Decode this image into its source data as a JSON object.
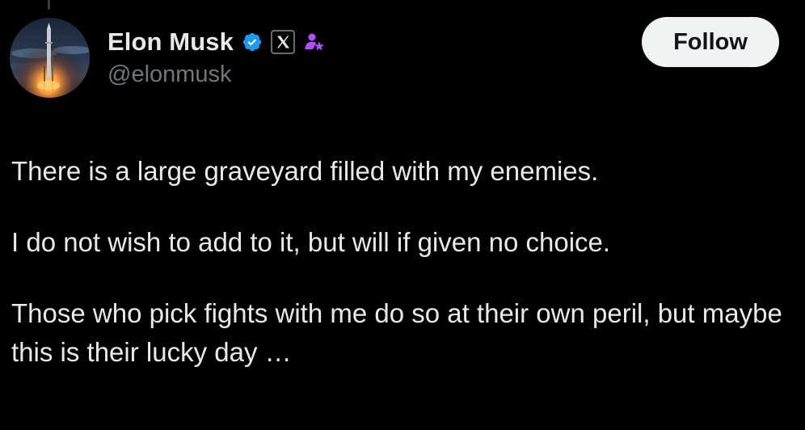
{
  "tweet": {
    "author": {
      "display_name": "Elon Musk",
      "handle": "@elonmusk",
      "avatar_icon": "starship-launch-avatar",
      "badges": [
        {
          "icon": "verified-check-icon",
          "color": "#1d9bf0"
        },
        {
          "icon": "x-logo-affiliate-icon",
          "color": "#e7e9ea"
        },
        {
          "icon": "government-official-icon",
          "color": "#b14dff"
        }
      ]
    },
    "follow_label": "Follow",
    "paragraphs": [
      "There is a large graveyard filled with my enemies.",
      "I do not wish to add to it, but will if given no choice.",
      "Those who pick fights with me do so at their own peril, but maybe this is their lucky day …"
    ]
  },
  "colors": {
    "background": "#000000",
    "text_primary": "#e7e9ea",
    "text_secondary": "#71767b",
    "follow_button_bg": "#eff3f4",
    "follow_button_text": "#0f1419",
    "verified_blue": "#1d9bf0"
  }
}
